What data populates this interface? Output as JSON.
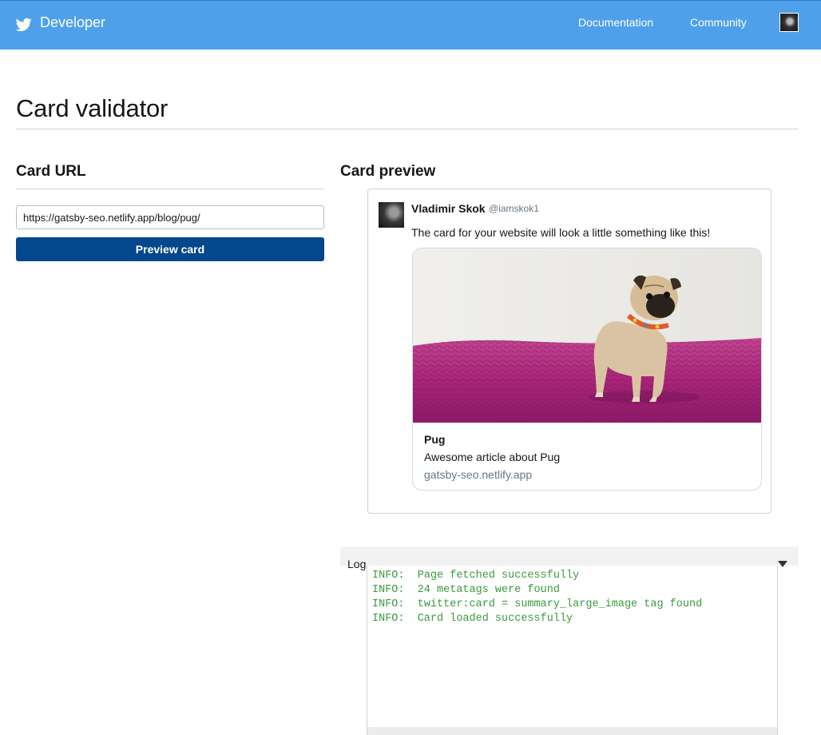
{
  "topbar": {
    "brand": "Developer",
    "nav": [
      "Documentation",
      "Community"
    ],
    "avatar_icon": "user-avatar"
  },
  "colors": {
    "topbar": "#4ea0ea",
    "primary_button": "#03478c",
    "log_text": "#3c9a3c"
  },
  "page": {
    "title": "Card validator"
  },
  "card_url": {
    "heading": "Card URL",
    "input_value": "https://gatsby-seo.netlify.app/blog/pug/",
    "button_label": "Preview card"
  },
  "preview": {
    "heading": "Card preview",
    "author_name": "Vladimir Skok",
    "author_handle": "@iamskok1",
    "tweet_text": "The card for your website will look a little something like this!",
    "card": {
      "title": "Pug",
      "description": "Awesome article about Pug",
      "domain": "gatsby-seo.netlify.app"
    }
  },
  "log": {
    "label": "Log",
    "lines": [
      "INFO:  Page fetched successfully",
      "INFO:  24 metatags were found",
      "INFO:  twitter:card = summary_large_image tag found",
      "INFO:  Card loaded successfully"
    ]
  }
}
